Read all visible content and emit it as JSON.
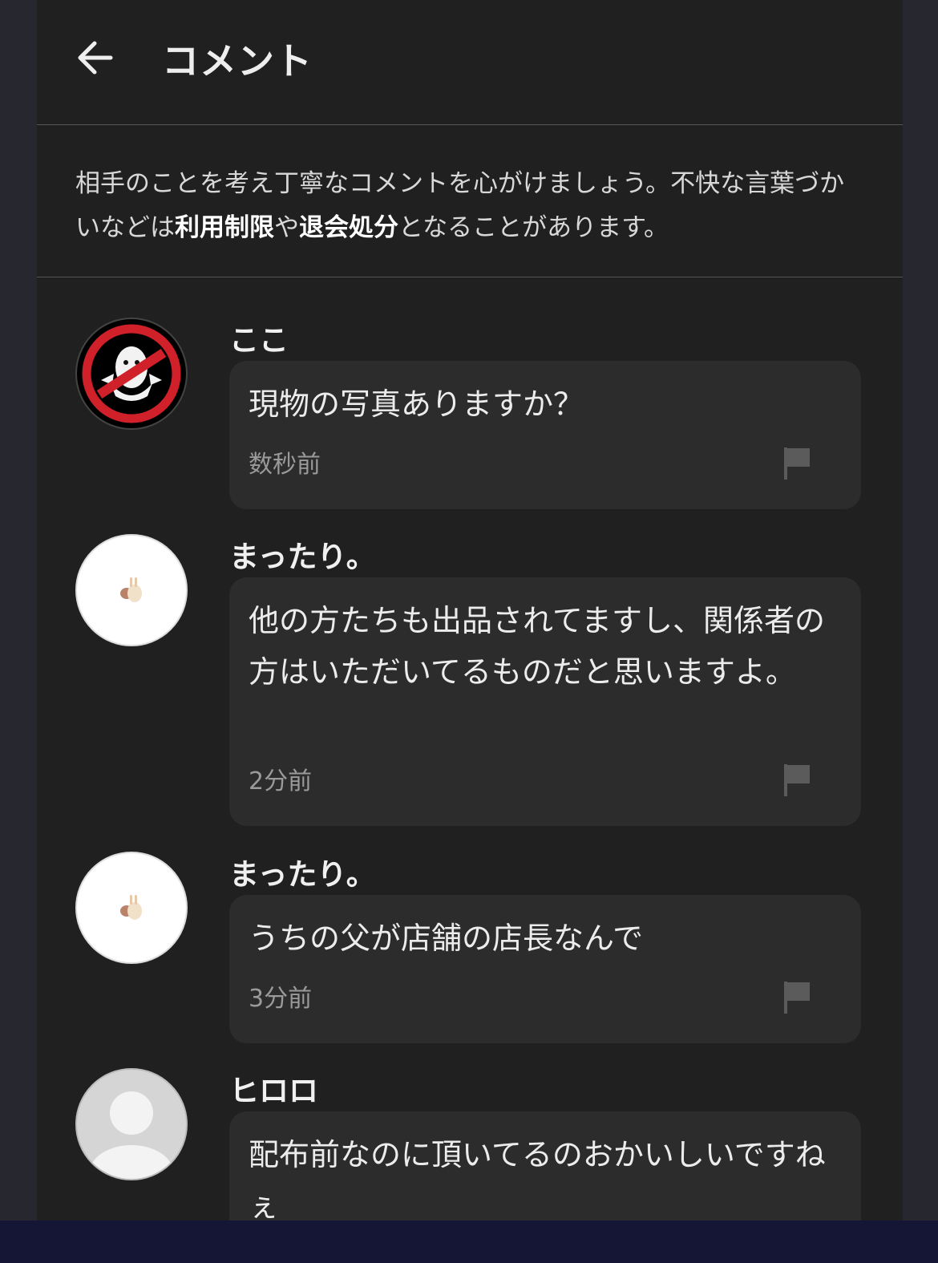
{
  "header": {
    "title": "コメント",
    "back_icon": "arrow-left-icon"
  },
  "notice": {
    "part1": "相手のことを考え丁寧なコメントを心がけましょう。不快な言葉づかいなどは",
    "bold1": "利用制限",
    "part2": "や",
    "bold2": "退会処分",
    "part3": "となることがあります。"
  },
  "comments": [
    {
      "user": "ここ",
      "avatar": "ghostbusters-logo-avatar",
      "text": "現物の写真ありますか？",
      "time": "数秒前"
    },
    {
      "user": "まったり。",
      "avatar": "bunny-sticker-avatar",
      "text": "他の方たちも出品されてますし、関係者の方はいただいてるものだと思いますよ。",
      "time": "2分前"
    },
    {
      "user": "まったり。",
      "avatar": "bunny-sticker-avatar",
      "text": "うちの父が店舗の店長なんで",
      "time": "3分前"
    },
    {
      "user": "ヒロロ",
      "avatar": "default-user-avatar",
      "text": "配布前なのに頂いてるのおかいしいですねぇ",
      "time": ""
    }
  ],
  "colors": {
    "panel_bg": "#202020",
    "bubble_bg": "#2c2c2c",
    "page_bg": "#26272f",
    "bottom_bar": "#151536"
  }
}
